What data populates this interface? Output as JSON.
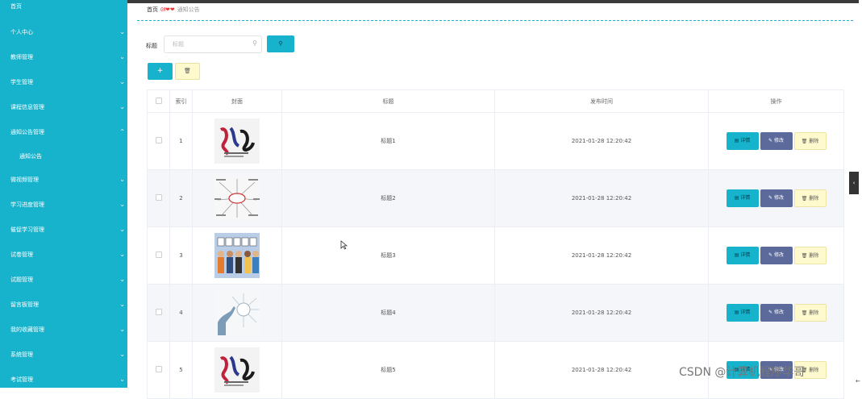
{
  "sidebar": {
    "top_item": "首页",
    "items": [
      {
        "label": "个人中心",
        "chevron": "⌄"
      },
      {
        "label": "教师管理",
        "chevron": "⌄"
      },
      {
        "label": "学生管理",
        "chevron": "⌄"
      },
      {
        "label": "课程信息管理",
        "chevron": "⌄"
      },
      {
        "label": "通知公告管理",
        "chevron": "⌃"
      },
      {
        "label": "通知公告",
        "sub": true
      },
      {
        "label": "微视频管理",
        "chevron": "⌄"
      },
      {
        "label": "学习进度管理",
        "chevron": "⌄"
      },
      {
        "label": "催促学习管理",
        "chevron": "⌄"
      },
      {
        "label": "试卷管理",
        "chevron": "⌄"
      },
      {
        "label": "试题管理",
        "chevron": "⌄"
      },
      {
        "label": "留言板管理",
        "chevron": "⌄"
      },
      {
        "label": "我的收藏管理",
        "chevron": "⌄"
      },
      {
        "label": "系统管理",
        "chevron": "⌄"
      },
      {
        "label": "考试管理",
        "chevron": "⌄"
      }
    ]
  },
  "breadcrumb": {
    "home": "首页",
    "separator": "ᘛ❤❤",
    "current": "通知公告"
  },
  "search": {
    "label": "标题",
    "placeholder": "标题",
    "icon": "search-icon",
    "button_icon": "search-icon"
  },
  "actions": {
    "add_icon": "+",
    "delete_icon": "🗑"
  },
  "table": {
    "headers": [
      "",
      "索引",
      "封面",
      "标题",
      "发布时间",
      "操作"
    ],
    "rows": [
      {
        "index": "1",
        "title": "标题1",
        "time": "2021-01-28 12:20:42",
        "cover": "cover-calligraphy"
      },
      {
        "index": "2",
        "title": "标题2",
        "time": "2021-01-28 12:20:42",
        "cover": "cover-mindmap"
      },
      {
        "index": "3",
        "title": "标题3",
        "time": "2021-01-28 12:20:42",
        "cover": "cover-hello-people"
      },
      {
        "index": "4",
        "title": "标题4",
        "time": "2021-01-28 12:20:42",
        "cover": "cover-business-thinking"
      },
      {
        "index": "5",
        "title": "标题5",
        "time": "2021-01-28 12:20:42",
        "cover": "cover-calligraphy"
      }
    ],
    "ops": {
      "detail": "详情",
      "edit": "修改",
      "remove": "删除"
    }
  },
  "watermark": "CSDN @计算机程序华哥",
  "colors": {
    "accent": "#17b3cd",
    "edit": "#5b6a9a",
    "remove": "#fffacd"
  }
}
